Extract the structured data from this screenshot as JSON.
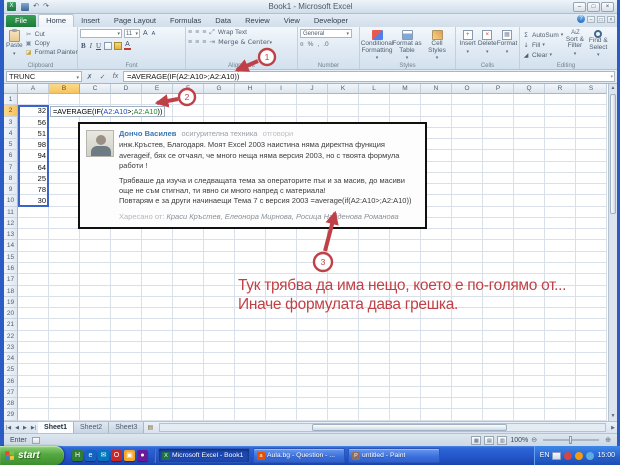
{
  "window": {
    "title": "Book1  -  Microsoft Excel",
    "controls": {
      "minimize": "‒",
      "restore": "□",
      "close": "×"
    },
    "qat": {
      "undo": "↶",
      "redo": "↷"
    }
  },
  "ribbon": {
    "active_tab": "home",
    "tabs": [
      {
        "id": "file",
        "label": "File"
      },
      {
        "id": "home",
        "label": "Home"
      },
      {
        "id": "insert",
        "label": "Insert"
      },
      {
        "id": "page-layout",
        "label": "Page Layout"
      },
      {
        "id": "formulas",
        "label": "Formulas"
      },
      {
        "id": "data",
        "label": "Data"
      },
      {
        "id": "review",
        "label": "Review"
      },
      {
        "id": "view",
        "label": "View"
      },
      {
        "id": "developer",
        "label": "Developer"
      }
    ],
    "help_icon": "?",
    "clipboard": {
      "label": "Clipboard",
      "paste": "Paste",
      "cut": "Cut",
      "copy": "Copy",
      "format_painter": "Format Painter"
    },
    "font": {
      "label": "Font",
      "size": "11",
      "bold": "B",
      "italic": "I",
      "underline": "U",
      "grow": "A",
      "shrink": "A",
      "fontcolor": "A"
    },
    "alignment": {
      "label": "Alignment",
      "wrap": "Wrap Text",
      "merge": "Merge & Center"
    },
    "number": {
      "label": "Number",
      "format": "General",
      "currency": "¤",
      "percent": "%",
      "comma": ",",
      "decimals": ".0"
    },
    "styles": {
      "label": "Styles",
      "conditional": "Conditional Formatting",
      "format_table": "Format as Table",
      "cell_styles": "Cell Styles"
    },
    "cells": {
      "label": "Cells",
      "insert": "Insert",
      "delete": "Delete",
      "format": "Format"
    },
    "editing": {
      "label": "Editing",
      "sigma": "Σ",
      "autosum": "AutoSum",
      "fill": "Fill",
      "clear": "Clear",
      "sort": "Sort & Filter",
      "find": "Find & Select",
      "az": "A↓Z"
    }
  },
  "formula_bar": {
    "name_box": "TRUNC",
    "cancel": "✗",
    "enter": "✓",
    "fx": "fx",
    "formula": "=AVERAGE(IF(A2:A10>;A2:A10))"
  },
  "grid": {
    "columns": [
      "A",
      "B",
      "C",
      "D",
      "E",
      "F",
      "G",
      "H",
      "I",
      "J",
      "K",
      "L",
      "M",
      "N",
      "O",
      "P",
      "Q",
      "R",
      "S"
    ],
    "row_count": 29,
    "active_column": "B",
    "active_row": 2,
    "a_values": {
      "2": "32",
      "3": "56",
      "4": "51",
      "5": "98",
      "6": "94",
      "7": "64",
      "8": "25",
      "9": "78",
      "10": "30"
    },
    "b2_formula": [
      {
        "text": "=AVERAGE(IF(",
        "color": "#000000"
      },
      {
        "text": "A2:A10",
        "color": "#1c49c8"
      },
      {
        "text": ">;",
        "color": "#000000"
      },
      {
        "text": "A2:A10",
        "color": "#1e8a27"
      },
      {
        "text": "))",
        "color": "#000000"
      }
    ]
  },
  "comment_box": {
    "author": "Дончо Василев",
    "author_role": "осигурителна техника",
    "reply_label": "отговори",
    "para1": "инж.Кръстев, Благодаря. Моят Excel 2003 наистина няма директна функция averageif, бях се отчаял, че много неща няма версия 2003, но с твоята формула работи !",
    "para2": "Трябваше да изуча и следващата тема за операторите пък и за масив, до масиви още не съм стигнал, ти явно си много напред с материала!",
    "para3": "Повтарям е за други начинаещи Тема 7 с версия 2003   =average(if(A2:A10>;A2:A10))",
    "liked_label": "Харесано от:",
    "liked_names": "Краси Кръстев,  Елеонора Мирнова,  Росица Найденова Романова"
  },
  "annotations": {
    "color": "#bf4147",
    "badge1": "1",
    "badge2": "2",
    "badge3": "3",
    "note_line1": "Тук трябва да има нещо, което е по-голямо от...",
    "note_line2": "Иначе формулата дава грешка."
  },
  "sheet_bar": {
    "tabs": [
      {
        "label": "Sheet1",
        "active": true
      },
      {
        "label": "Sheet2",
        "active": false
      },
      {
        "label": "Sheet3",
        "active": false
      }
    ]
  },
  "status_bar": {
    "mode": "Enter",
    "zoom": "100%"
  },
  "taskbar": {
    "start_label": "start",
    "quicklaunch": [
      {
        "name": "quicklaunch-app-icon",
        "glyph": "H",
        "color": "#2e7d32"
      },
      {
        "name": "quicklaunch-ie-icon",
        "glyph": "e",
        "color": "#1565c0"
      },
      {
        "name": "quicklaunch-mail-icon",
        "glyph": "✉",
        "color": "#0277bd"
      },
      {
        "name": "quicklaunch-opera-icon",
        "glyph": "O",
        "color": "#c62828"
      },
      {
        "name": "quicklaunch-folder-icon",
        "glyph": "▣",
        "color": "#f9a825"
      },
      {
        "name": "quicklaunch-media-icon",
        "glyph": "●",
        "color": "#6a1b9a"
      }
    ],
    "buttons": [
      {
        "label": "Microsoft Excel - Book1",
        "active": true,
        "icon": "X",
        "icon_color": "#1e7145"
      },
      {
        "label": "Aula.bg - Question - ...",
        "active": false,
        "icon": "a",
        "icon_color": "#e65100"
      },
      {
        "label": "untitled - Paint",
        "active": false,
        "icon": "P",
        "icon_color": "#8d6e63"
      }
    ],
    "tray": {
      "lang": "EN",
      "clock": "15:00"
    }
  }
}
